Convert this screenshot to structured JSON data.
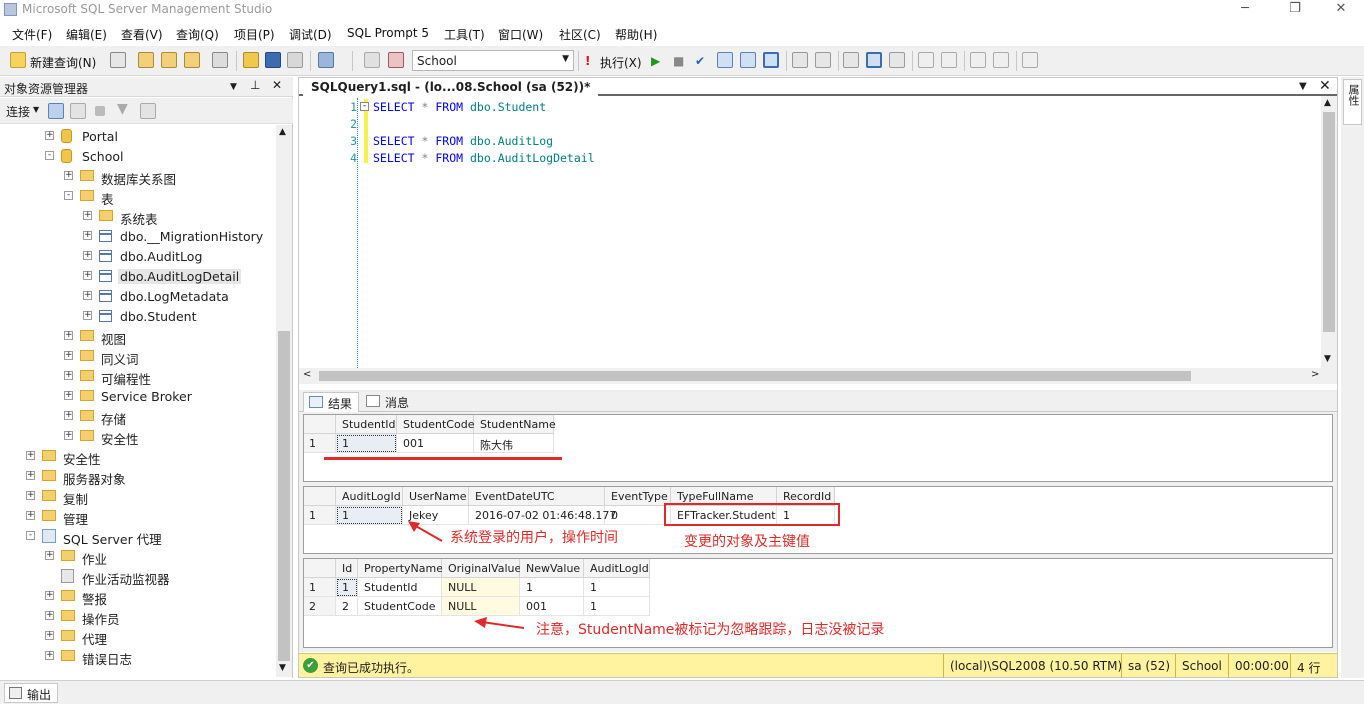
{
  "window": {
    "title": "Microsoft SQL Server Management Studio"
  },
  "menu": [
    "文件(F)",
    "编辑(E)",
    "查看(V)",
    "查询(Q)",
    "项目(P)",
    "调试(D)",
    "SQL Prompt 5",
    "工具(T)",
    "窗口(W)",
    "社区(C)",
    "帮助(H)"
  ],
  "toolbar": {
    "new_query": "新建查询(N)",
    "database": "School",
    "execute": "执行(X)"
  },
  "object_explorer": {
    "title": "对象资源管理器",
    "connect": "连接",
    "tree": [
      {
        "label": "Portal",
        "kind": "db",
        "level": 2,
        "toggle": "+"
      },
      {
        "label": "School",
        "kind": "db",
        "level": 2,
        "toggle": "-"
      },
      {
        "label": "数据库关系图",
        "kind": "folder",
        "level": 3,
        "toggle": "+"
      },
      {
        "label": "表",
        "kind": "folder",
        "level": 3,
        "toggle": "-"
      },
      {
        "label": "系统表",
        "kind": "folder",
        "level": 4,
        "toggle": "+"
      },
      {
        "label": "dbo.__MigrationHistory",
        "kind": "table",
        "level": 4,
        "toggle": "+"
      },
      {
        "label": "dbo.AuditLog",
        "kind": "table",
        "level": 4,
        "toggle": "+"
      },
      {
        "label": "dbo.AuditLogDetail",
        "kind": "table",
        "level": 4,
        "toggle": "+",
        "selected": true
      },
      {
        "label": "dbo.LogMetadata",
        "kind": "table",
        "level": 4,
        "toggle": "+"
      },
      {
        "label": "dbo.Student",
        "kind": "table",
        "level": 4,
        "toggle": "+"
      },
      {
        "label": "视图",
        "kind": "folder",
        "level": 3,
        "toggle": "+"
      },
      {
        "label": "同义词",
        "kind": "folder",
        "level": 3,
        "toggle": "+"
      },
      {
        "label": "可编程性",
        "kind": "folder",
        "level": 3,
        "toggle": "+"
      },
      {
        "label": "Service Broker",
        "kind": "folder",
        "level": 3,
        "toggle": "+"
      },
      {
        "label": "存储",
        "kind": "folder",
        "level": 3,
        "toggle": "+"
      },
      {
        "label": "安全性",
        "kind": "folder",
        "level": 3,
        "toggle": "+"
      },
      {
        "label": "安全性",
        "kind": "folder",
        "level": 1,
        "toggle": "+"
      },
      {
        "label": "服务器对象",
        "kind": "folder",
        "level": 1,
        "toggle": "+"
      },
      {
        "label": "复制",
        "kind": "folder",
        "level": 1,
        "toggle": "+"
      },
      {
        "label": "管理",
        "kind": "folder",
        "level": 1,
        "toggle": "+"
      },
      {
        "label": "SQL Server 代理",
        "kind": "agent",
        "level": 1,
        "toggle": "-"
      },
      {
        "label": "作业",
        "kind": "folder",
        "level": 2,
        "toggle": "+"
      },
      {
        "label": "作业活动监视器",
        "kind": "monitor",
        "level": 2,
        "toggle": ""
      },
      {
        "label": "警报",
        "kind": "folder",
        "level": 2,
        "toggle": "+"
      },
      {
        "label": "操作员",
        "kind": "folder",
        "level": 2,
        "toggle": "+"
      },
      {
        "label": "代理",
        "kind": "folder",
        "level": 2,
        "toggle": "+"
      },
      {
        "label": "错误日志",
        "kind": "folder",
        "level": 2,
        "toggle": "+"
      }
    ]
  },
  "editor": {
    "tab": "SQLQuery1.sql - (lo...08.School (sa (52))*",
    "lines": [
      {
        "n": "1",
        "text": "SELECT * FROM dbo.Student",
        "table": "dbo.Student"
      },
      {
        "n": "2",
        "text": "",
        "table": ""
      },
      {
        "n": "3",
        "text": "SELECT * FROM dbo.AuditLog",
        "table": "dbo.AuditLog"
      },
      {
        "n": "4",
        "text": "SELECT * FROM dbo.AuditLogDetail",
        "table": "dbo.AuditLogDetail"
      }
    ]
  },
  "results": {
    "tabs": [
      "结果",
      "消息"
    ],
    "grid1": {
      "columns": [
        "StudentId",
        "StudentCode",
        "StudentName"
      ],
      "rows": [
        [
          "1",
          "1",
          "001",
          "陈大伟"
        ]
      ]
    },
    "grid2": {
      "columns": [
        "AuditLogId",
        "UserName",
        "EventDateUTC",
        "EventType",
        "TypeFullName",
        "RecordId"
      ],
      "rows": [
        [
          "1",
          "1",
          "Jekey",
          "2016-07-02 01:46:48.177",
          "0",
          "EFTracker.Student",
          "1"
        ]
      ]
    },
    "grid3": {
      "columns": [
        "Id",
        "PropertyName",
        "OriginalValue",
        "NewValue",
        "AuditLogId"
      ],
      "rows": [
        [
          "1",
          "1",
          "StudentId",
          "NULL",
          "1",
          "1"
        ],
        [
          "2",
          "2",
          "StudentCode",
          "NULL",
          "001",
          "1"
        ]
      ]
    }
  },
  "annotations": {
    "user_time": "系统登录的用户，操作时间",
    "object_key": "变更的对象及主键值",
    "note": "注意，StudentName被标记为忽略跟踪，日志没被记录"
  },
  "status": {
    "message": "查询已成功执行。",
    "server": "(local)\\SQL2008 (10.50 RTM)",
    "user": "sa (52)",
    "db": "School",
    "time": "00:00:00",
    "rows": "4 行"
  },
  "right_panel": {
    "tab": "属性"
  },
  "bottom": {
    "output_tab": "输出"
  },
  "colors": {
    "status_bar": "#fff3a0",
    "keyword": "#0000ff",
    "annotation": "#e02a2a"
  }
}
